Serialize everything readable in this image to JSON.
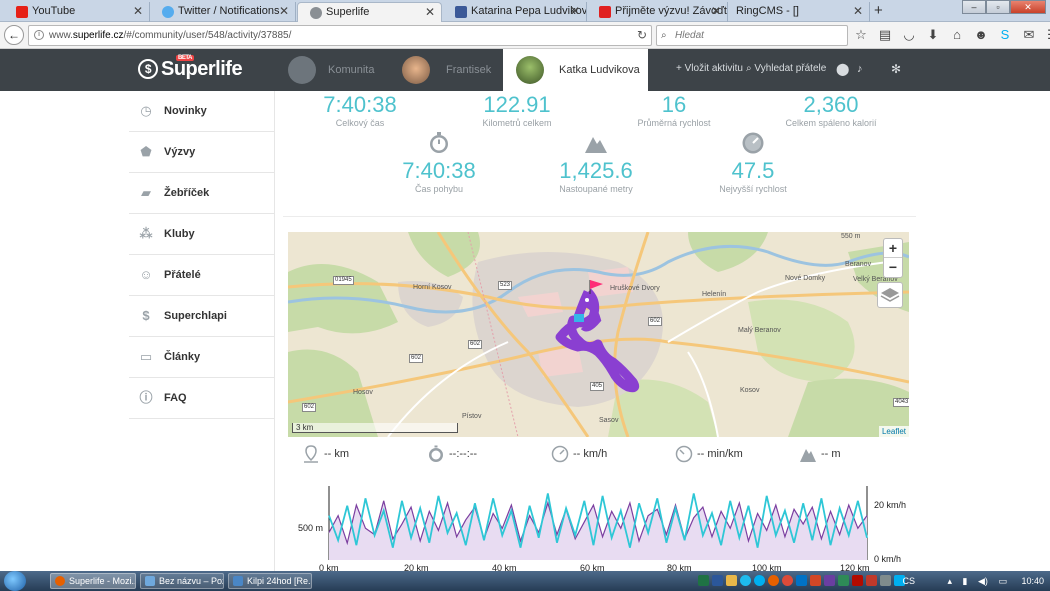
{
  "browser": {
    "tabs": [
      {
        "label": "YouTube",
        "color": "#e62117"
      },
      {
        "label": "Twitter / Notifications",
        "color": "#55acee"
      },
      {
        "label": "Superlife",
        "color": "#8a8f94"
      },
      {
        "label": "Katarina Pepa Ludviková",
        "color": "#3b5998"
      },
      {
        "label": "Přijměte výzvu! Závoďte na...",
        "color": "#e02020"
      },
      {
        "label": "RingCMS - []",
        "color": "#cccccc"
      }
    ],
    "url_prefix": "www.",
    "url_host": "superlife.cz",
    "url_path": "/#/community/user/548/activity/37885/",
    "search_placeholder": "Hledat"
  },
  "header": {
    "logo": "Superlife",
    "beta": "BETA",
    "nav_community": "Komunita",
    "nav_user1": "Frantisek",
    "nav_user2": "Katka Ludvikova",
    "add_activity": "Vložit aktivitu",
    "find_friends": "Vyhledat přátele"
  },
  "sidebar": {
    "items": [
      {
        "label": "Novinky",
        "icon": "stopwatch-icon"
      },
      {
        "label": "Výzvy",
        "icon": "badge-icon"
      },
      {
        "label": "Žebříček",
        "icon": "ranking-icon"
      },
      {
        "label": "Kluby",
        "icon": "group-icon"
      },
      {
        "label": "Přátelé",
        "icon": "smiley-icon"
      },
      {
        "label": "Superchlapi",
        "icon": "superlife-icon"
      },
      {
        "label": "Články",
        "icon": "articles-icon"
      },
      {
        "label": "FAQ",
        "icon": "info-icon"
      }
    ]
  },
  "stats": {
    "total_time": {
      "value": "7:40:38",
      "label": "Celkový čas"
    },
    "total_km": {
      "value": "122.91",
      "label": "Kilometrů celkem"
    },
    "avg_speed": {
      "value": "16",
      "label": "Průměrná rychlost"
    },
    "calories": {
      "value": "2,360",
      "label": "Celkem spáleno kalorií"
    },
    "moving_time": {
      "value": "7:40:38",
      "label": "Čas pohybu"
    },
    "ascent": {
      "value": "1,425.6",
      "label": "Nastoupané metry"
    },
    "max_speed": {
      "value": "47.5",
      "label": "Nejvyšší rychlost"
    }
  },
  "map": {
    "zoom_in": "+",
    "zoom_out": "−",
    "scale": "3 km",
    "attribution": "Leaflet",
    "places": {
      "hruskove_dvory": "Hruškové Dvory",
      "beranov": "Beranov",
      "velky_beranov": "Velký Beranov",
      "nove_domky": "Nové Domky",
      "helenin": "Helenín",
      "maly_beranov": "Malý Beranov",
      "horni_kosov": "Horní Kosov",
      "hosov": "Hosov",
      "kosov": "Kosov",
      "pistov": "Pístov",
      "sasov": "Sasov",
      "elev_550": "550 m"
    },
    "roads": [
      "523",
      "01945",
      "602",
      "602",
      "602",
      "405",
      "602",
      "4043"
    ],
    "route_color": "#8a3fd1"
  },
  "live": {
    "distance": "-- km",
    "time": "--:--:--",
    "speed": "-- km/h",
    "pace": "-- min/km",
    "elevation": "-- m"
  },
  "chart_data": {
    "type": "line",
    "x_ticks": [
      "0 km",
      "20 km",
      "40 km",
      "60 km",
      "80 km",
      "100 km",
      "120 km"
    ],
    "xlim": [
      0,
      122.91
    ],
    "left_axis_label": "500 m",
    "right_axis_labels": [
      "20 km/h",
      "0 km/h"
    ],
    "series": [
      {
        "color": "#7b3fa0",
        "values": [
          480,
          560,
          430,
          610,
          500,
          470,
          630,
          450,
          520,
          600,
          440,
          580,
          490,
          620,
          460,
          540,
          600,
          450,
          570,
          500,
          610,
          440,
          560,
          480,
          620,
          470,
          590,
          450,
          530,
          610,
          460,
          580,
          500,
          620,
          440,
          560,
          590,
          470,
          610,
          450,
          550,
          600,
          460,
          580,
          500,
          620,
          440,
          570,
          490,
          610,
          460,
          590,
          520,
          600,
          450,
          580,
          470,
          610,
          500,
          560
        ]
      },
      {
        "color": "#2ec7d6",
        "values": [
          18,
          8,
          22,
          6,
          25,
          10,
          20,
          5,
          24,
          9,
          21,
          7,
          26,
          11,
          19,
          6,
          23,
          8,
          25,
          10,
          20,
          5,
          22,
          9,
          27,
          7,
          21,
          10,
          24,
          6,
          26,
          9,
          20,
          5,
          23,
          11,
          25,
          7,
          21,
          8,
          27,
          10,
          19,
          6,
          24,
          9,
          22,
          5,
          26,
          10,
          20,
          7,
          23,
          8,
          25,
          6,
          21,
          10,
          24,
          9
        ]
      }
    ]
  },
  "taskbar": {
    "tasks": [
      {
        "label": "Superlife - Mozi...",
        "color": "#e66000"
      },
      {
        "label": "Bez názvu – Poz...",
        "color": "#6fa8dc"
      },
      {
        "label": "Kilpi 24hod [Re...",
        "color": "#4a86c5"
      }
    ],
    "lang": "CS",
    "clock": "10:40"
  }
}
